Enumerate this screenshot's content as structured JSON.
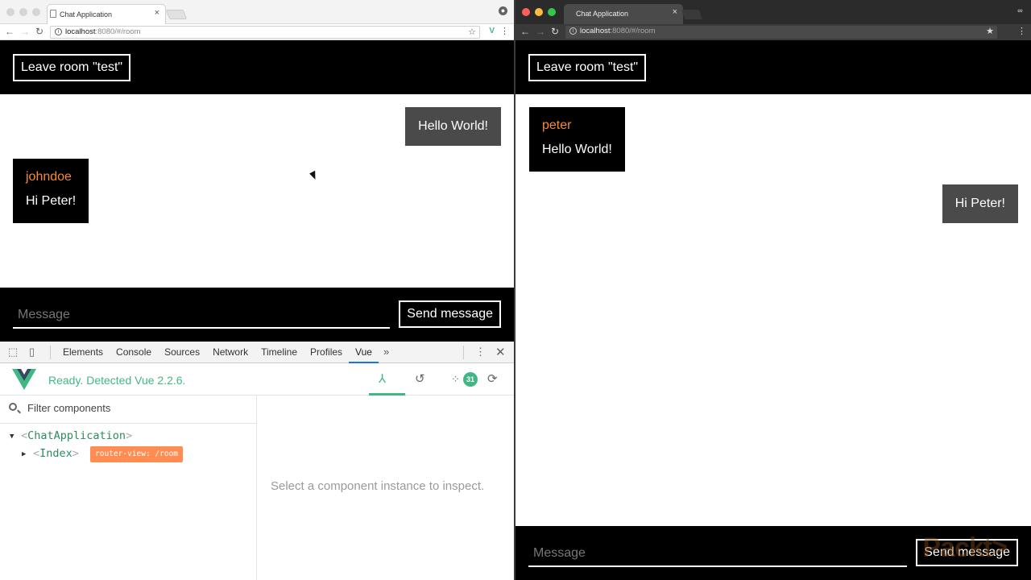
{
  "left_window": {
    "tab_title": "Chat Application",
    "tab_close": "×",
    "url_host": "localhost",
    "url_rest": ":8080/#/room",
    "header": {
      "leave_label": "Leave room \"test\""
    },
    "messages": [
      {
        "own": true,
        "author": "",
        "text": "Hello World!"
      },
      {
        "own": false,
        "author": "johndoe",
        "text": "Hi Peter!"
      }
    ],
    "composer": {
      "placeholder": "Message",
      "send_label": "Send message"
    },
    "devtools": {
      "tabs": [
        "Elements",
        "Console",
        "Sources",
        "Network",
        "Timeline",
        "Profiles",
        "Vue"
      ],
      "active_tab": "Vue",
      "more": "»",
      "vue_status": "Ready. Detected Vue 2.2.6.",
      "event_count": "31",
      "filter_placeholder": "Filter components",
      "tree": {
        "root": "ChatApplication",
        "child": "Index",
        "child_badge": "router-view: /room"
      },
      "inspect_message": "Select a component instance to inspect."
    }
  },
  "right_window": {
    "tab_title": "Chat Application",
    "tab_close": "×",
    "url_host": "localhost",
    "url_rest": ":8080/#/room",
    "header": {
      "leave_label": "Leave room \"test\""
    },
    "messages": [
      {
        "own": false,
        "author": "peter",
        "text": "Hello World!"
      },
      {
        "own": true,
        "author": "",
        "text": "Hi Peter!"
      }
    ],
    "composer": {
      "placeholder": "Message",
      "send_label": "Send message"
    },
    "watermark": "Packt>"
  },
  "colors": {
    "author": "#f58a33",
    "own_bubble": "#4a4a4a",
    "vue_green": "#41b883",
    "router_badge": "#ff8c52"
  },
  "icons": [
    "back-icon",
    "forward-icon",
    "reload-icon",
    "info-icon",
    "star-icon",
    "vue-extension-icon",
    "menu-icon",
    "profile-icon",
    "inspect-icon",
    "device-icon",
    "close-icon",
    "components-icon",
    "history-icon",
    "events-icon",
    "refresh-icon",
    "search-icon"
  ]
}
